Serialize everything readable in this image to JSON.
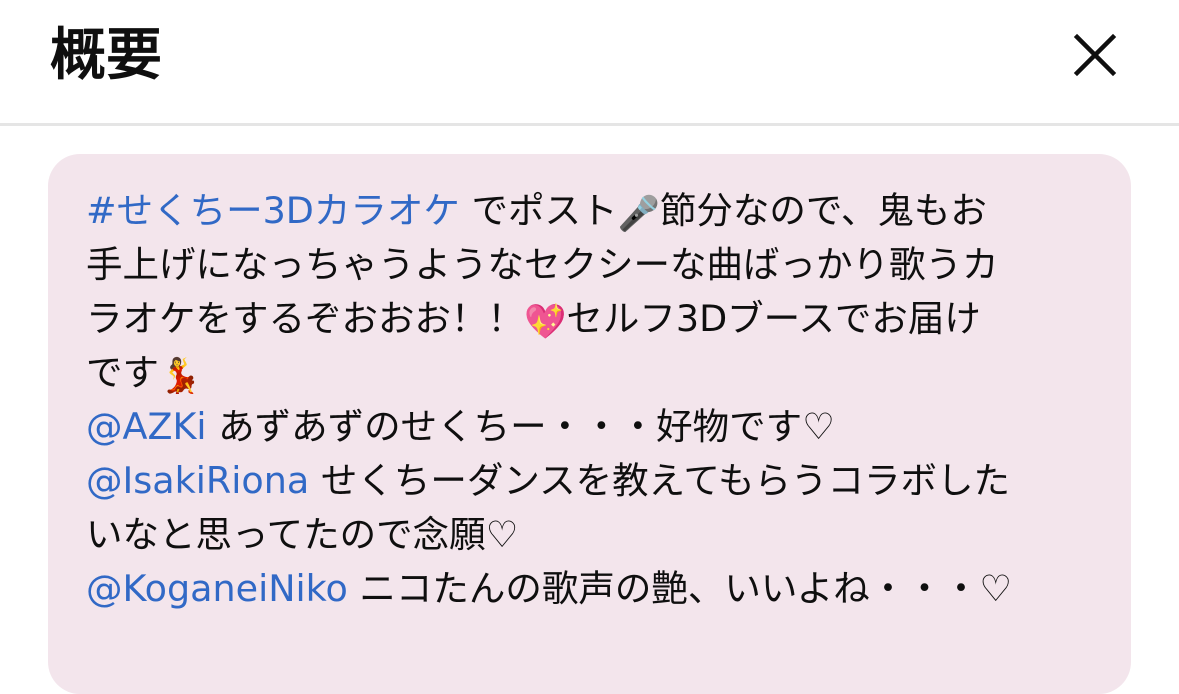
{
  "header": {
    "title": "概要",
    "close_icon": "close-icon"
  },
  "colors": {
    "card_background": "#f3e5ec",
    "link": "#3169c6",
    "text": "#0f0f0f",
    "divider": "#e5e5e5"
  },
  "description": {
    "hashtag": "#せくちー3Dカラオケ",
    "line1_text": " でポスト",
    "mic_emoji": "🎤",
    "line1_text2": "節分なので、鬼もお",
    "line2_text": "手上げになっちゃうようなセクシーな曲ばっかり歌うカ",
    "line3_text": "ラオケをするぞおおお！！",
    "heart_emoji": "💖",
    "line3_text2": "セルフ3Dブースでお届け",
    "line4_text": "です",
    "dancer_emoji": "💃",
    "mention1": "@AZKi",
    "mention1_text": " あずあずのせくちー・・・好物です♡",
    "mention2": "@IsakiRiona",
    "mention2_text": " せくちーダンスを教えてもらうコラボした",
    "line7_text": "いなと思ってたので念願♡",
    "mention3": "@KoganeiNiko",
    "mention3_text": " ニコたんの歌声の艶、いいよね・・・♡"
  }
}
